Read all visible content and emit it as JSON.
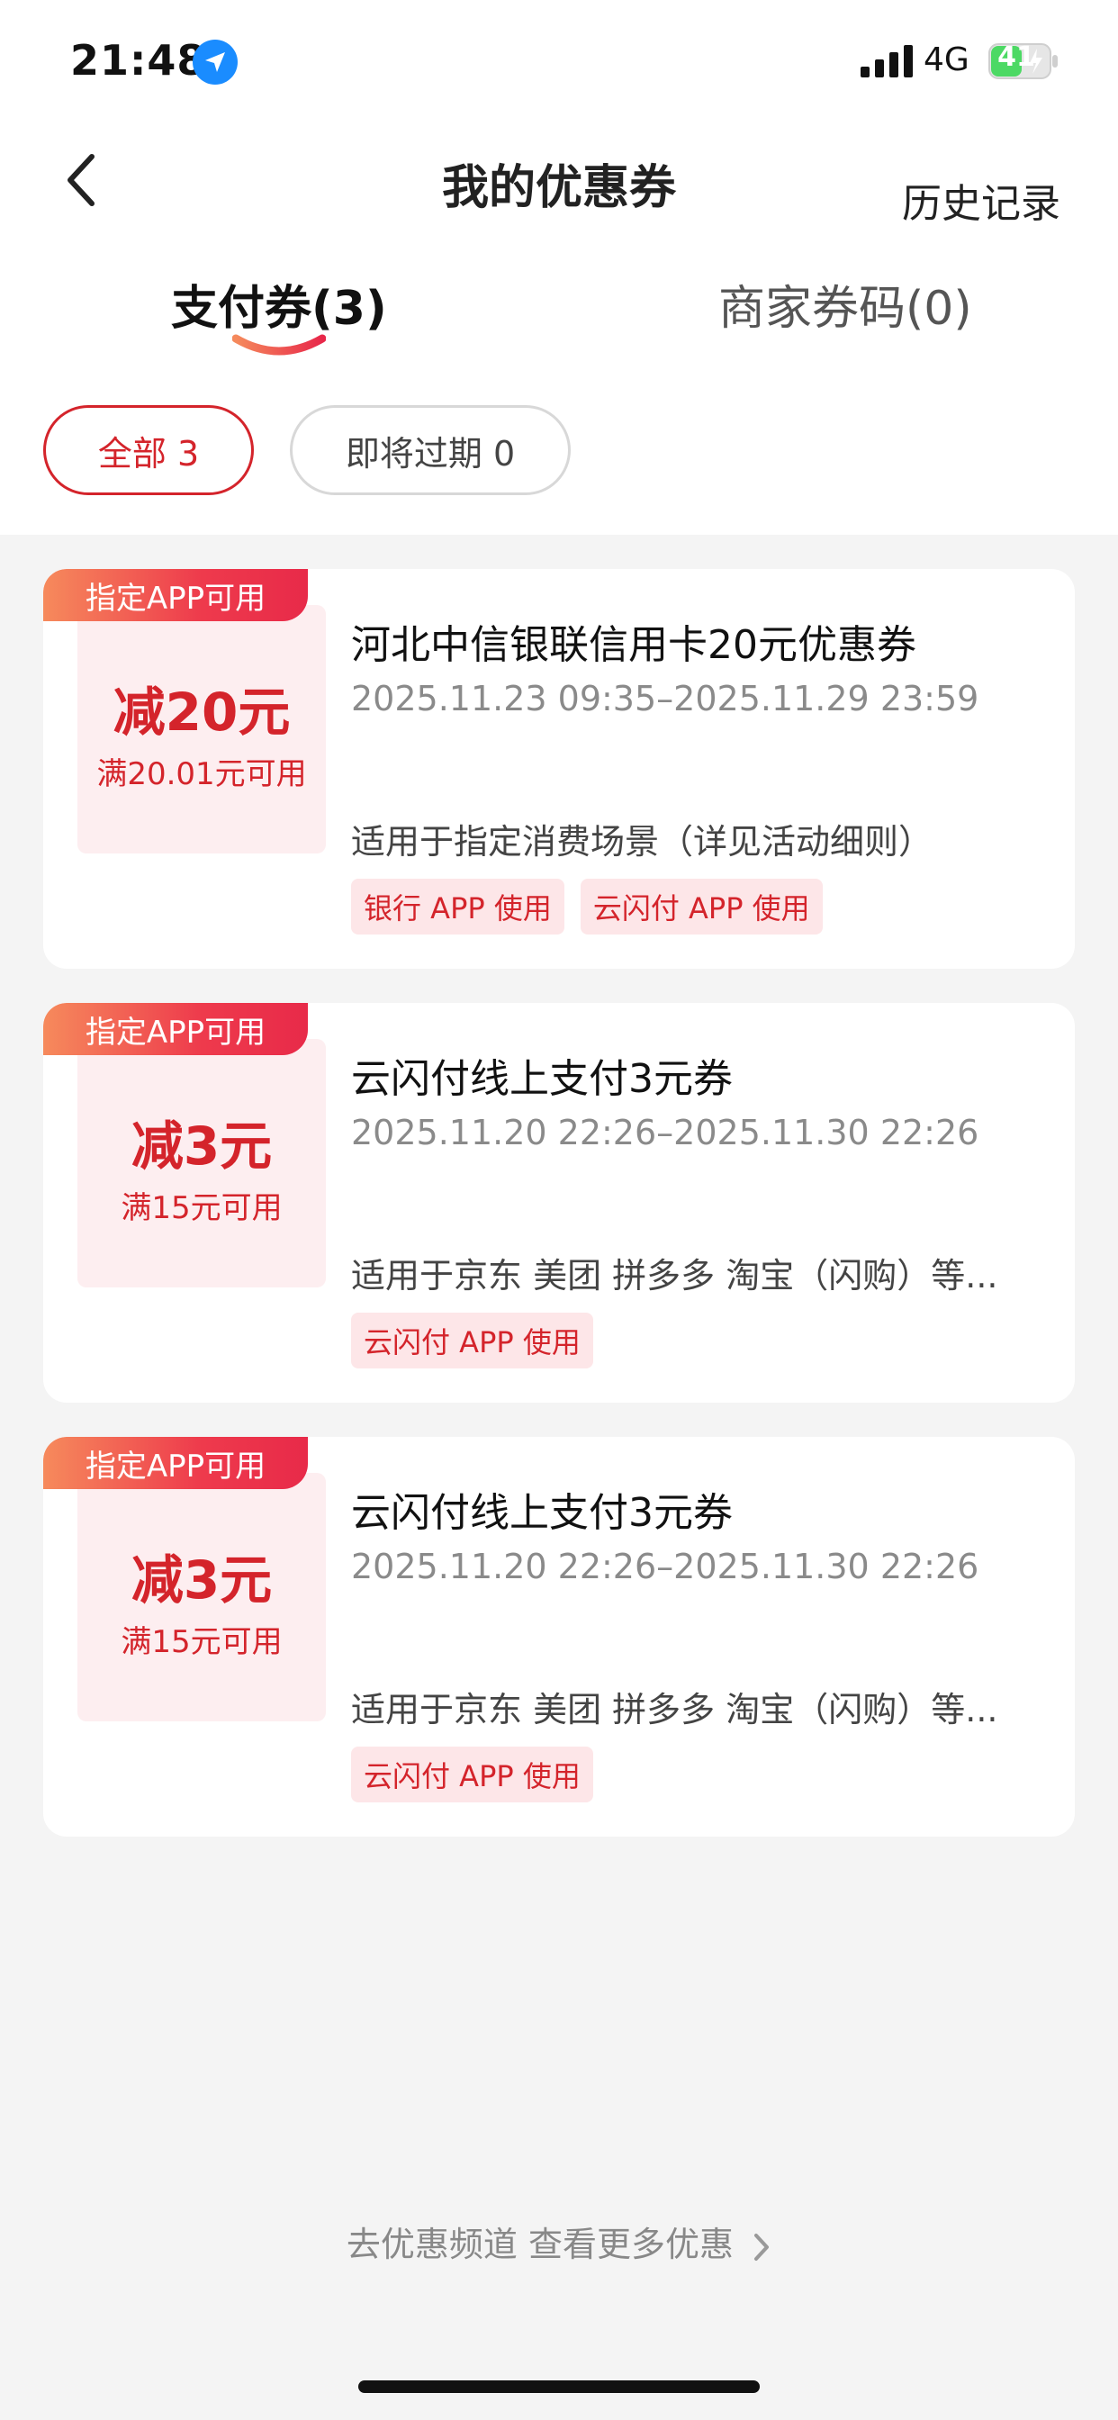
{
  "status_bar": {
    "time": "21:48",
    "network": "4G",
    "battery": "41"
  },
  "header": {
    "title": "我的优惠券",
    "history_label": "历史记录"
  },
  "tabs": [
    {
      "label": "支付券(3)",
      "active": true
    },
    {
      "label": "商家券码(0)",
      "active": false
    }
  ],
  "filters": [
    {
      "label": "全部 3",
      "active": true
    },
    {
      "label": "即将过期 0",
      "active": false
    }
  ],
  "coupons": [
    {
      "ribbon": "指定APP可用",
      "amount": "减20元",
      "threshold": "满20.01元可用",
      "title": "河北中信银联信用卡20元优惠券",
      "period": "2025.11.23 09:35–2025.11.29 23:59",
      "description": "适用于指定消费场景（详见活动细则）",
      "tags": [
        "银行 APP 使用",
        "云闪付 APP 使用"
      ]
    },
    {
      "ribbon": "指定APP可用",
      "amount": "减3元",
      "threshold": "满15元可用",
      "title": "云闪付线上支付3元券",
      "period": "2025.11.20 22:26–2025.11.30 22:26",
      "description": "适用于京东 美团 拼多多 淘宝（闪购）等...",
      "tags": [
        "云闪付 APP 使用"
      ]
    },
    {
      "ribbon": "指定APP可用",
      "amount": "减3元",
      "threshold": "满15元可用",
      "title": "云闪付线上支付3元券",
      "period": "2025.11.20 22:26–2025.11.30 22:26",
      "description": "适用于京东 美团 拼多多 淘宝（闪购）等...",
      "tags": [
        "云闪付 APP 使用"
      ]
    }
  ],
  "footer": {
    "link_label": "去优惠频道 查看更多优惠"
  },
  "colors": {
    "accent_red": "#d4242b",
    "tag_bg": "#fde6e8",
    "amount_bg": "#fdeef0",
    "page_bg": "#f4f4f4",
    "battery_green": "#4cd964"
  }
}
